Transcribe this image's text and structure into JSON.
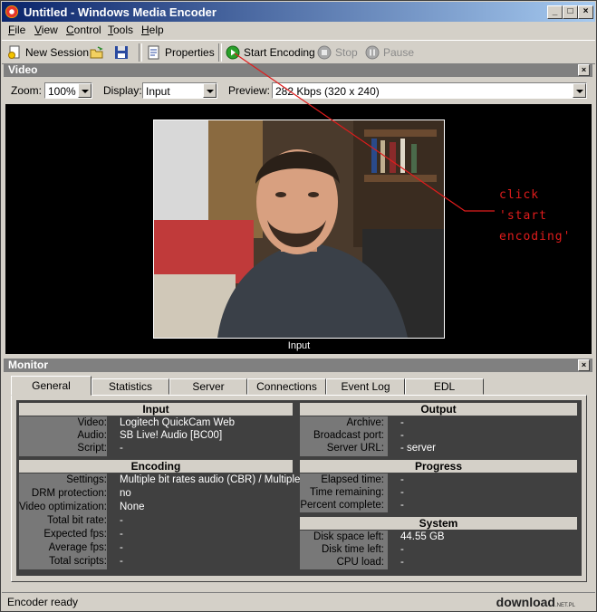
{
  "window": {
    "title": "Untitled - Windows Media Encoder",
    "min_glyph": "_",
    "max_glyph": "□",
    "close_glyph": "×"
  },
  "menu": [
    {
      "label": "File",
      "key": "F",
      "rest": "ile"
    },
    {
      "label": "View",
      "key": "V",
      "rest": "iew"
    },
    {
      "label": "Control",
      "key": "C",
      "rest": "ontrol"
    },
    {
      "label": "Tools",
      "key": "T",
      "rest": "ools"
    },
    {
      "label": "Help",
      "key": "H",
      "rest": "elp"
    }
  ],
  "toolbar": {
    "new_session": "New Session",
    "properties": "Properties",
    "start_encoding": "Start Encoding",
    "stop": "Stop",
    "pause": "Pause"
  },
  "video_panel": {
    "title": "Video",
    "close_glyph": "×",
    "zoom_label": "Zoom:",
    "zoom_value": "100%",
    "display_label": "Display:",
    "display_value": "Input",
    "preview_label": "Preview:",
    "preview_value": "282 Kbps (320 x 240)",
    "caption": "Input"
  },
  "annotation": {
    "line1": "click",
    "line2": "'start",
    "line3": "encoding'",
    "color": "#e01c1c"
  },
  "monitor_panel": {
    "title": "Monitor",
    "close_glyph": "×",
    "tabs": [
      "General",
      "Statistics",
      "Server",
      "Connections",
      "Event Log",
      "EDL"
    ],
    "active_tab": "General",
    "input": {
      "header": "Input",
      "rows": [
        {
          "key": "Video:",
          "value": "Logitech QuickCam Web"
        },
        {
          "key": "Audio:",
          "value": "SB Live! Audio [BC00]"
        },
        {
          "key": "Script:",
          "value": "-"
        }
      ]
    },
    "output": {
      "header": "Output",
      "rows": [
        {
          "key": "Archive:",
          "value": "-"
        },
        {
          "key": "Broadcast port:",
          "value": "-"
        },
        {
          "key": "Server URL:",
          "value": "-   server"
        }
      ]
    },
    "encoding": {
      "header": "Encoding",
      "rows": [
        {
          "key": "Settings:",
          "value": "Multiple bit rates audio (CBR) / Multiple"
        },
        {
          "key": "DRM protection:",
          "value": "no"
        },
        {
          "key": "Video optimization:",
          "value": "None"
        },
        {
          "key": "Total bit rate:",
          "value": "-"
        },
        {
          "key": "Expected fps:",
          "value": "-"
        },
        {
          "key": "Average fps:",
          "value": "-"
        },
        {
          "key": "Total scripts:",
          "value": "-"
        }
      ]
    },
    "progress": {
      "header": "Progress",
      "rows": [
        {
          "key": "Elapsed time:",
          "value": "-"
        },
        {
          "key": "Time remaining:",
          "value": "-"
        },
        {
          "key": "Percent complete:",
          "value": "-"
        }
      ]
    },
    "system": {
      "header": "System",
      "rows": [
        {
          "key": "Disk space left:",
          "value": "44.55 GB"
        },
        {
          "key": "Disk time left:",
          "value": "-"
        },
        {
          "key": "CPU load:",
          "value": "-"
        }
      ]
    }
  },
  "status": {
    "text": "Encoder ready"
  },
  "watermark": {
    "text": "download",
    "sub": ".NET.PL"
  }
}
